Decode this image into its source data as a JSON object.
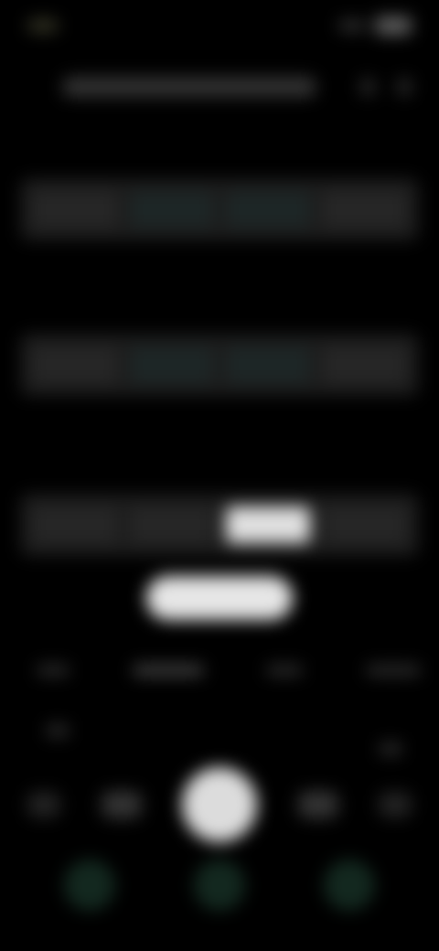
{
  "app": {
    "title": ""
  },
  "status_bar": {},
  "title": {
    "text": ""
  },
  "panels": [
    {
      "label": ""
    },
    {
      "label": ""
    },
    {
      "label": ""
    }
  ],
  "indicator_label": "",
  "tabs": [
    {
      "label": ""
    },
    {
      "label": ""
    },
    {
      "label": ""
    },
    {
      "label": ""
    }
  ],
  "controls": {
    "shutter_icon": "shutter-icon"
  },
  "navbar": {
    "icons": [
      "nav-back-icon",
      "nav-home-icon",
      "nav-recent-icon"
    ]
  }
}
